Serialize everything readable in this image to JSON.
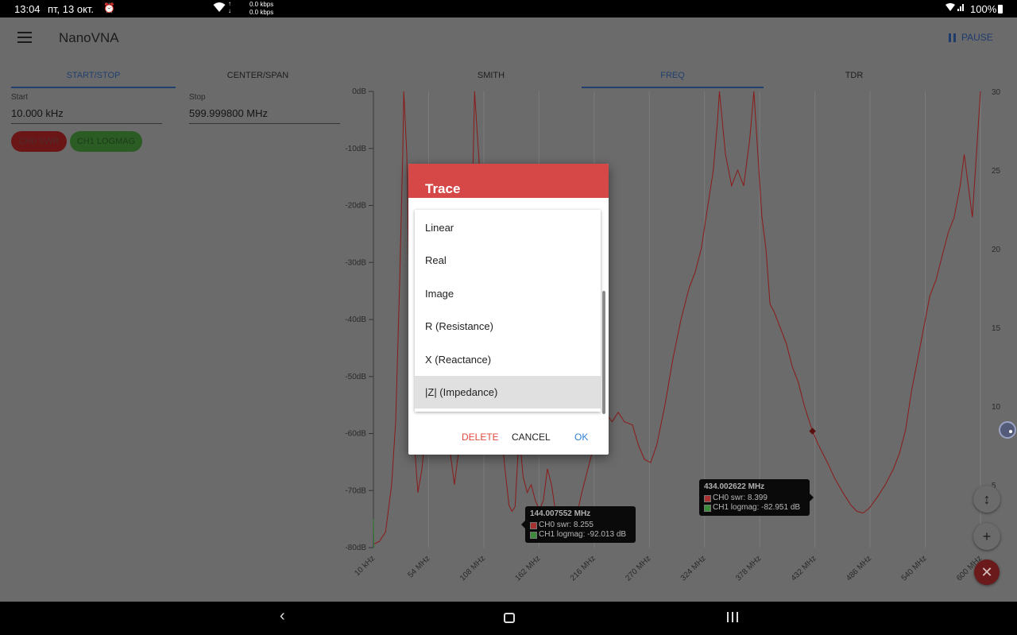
{
  "status": {
    "time": "13:04",
    "date": "пт, 13 окт.",
    "speed_up": "0.0 kbps",
    "speed_down": "0.0 kbps",
    "battery": "100%",
    "icons": [
      "alarm-icon",
      "wifi-icon",
      "data-arrows-icon",
      "wifi-signal-icon",
      "battery-icon"
    ]
  },
  "app": {
    "title": "NanoVNA",
    "pause_label": "PAUSE"
  },
  "left_tabs": [
    {
      "label": "START/STOP",
      "active": true
    },
    {
      "label": "CENTER/SPAN",
      "active": false
    }
  ],
  "fields": {
    "start_label": "Start",
    "start_value": "10.000 kHz",
    "stop_label": "Stop",
    "stop_value": "599.999800 MHz"
  },
  "chips": [
    {
      "label": "CH0 SWR",
      "color": "#c0392b"
    },
    {
      "label": "CH1 LOGMAG",
      "color": "#43a047"
    }
  ],
  "view_tabs": [
    {
      "label": "SMITH",
      "active": false
    },
    {
      "label": "FREQ",
      "active": true
    },
    {
      "label": "TDR",
      "active": false
    }
  ],
  "chart_data": {
    "type": "line",
    "x_unit": "MHz",
    "xlim": [
      0.01,
      600
    ],
    "x_ticks": [
      "10 kHz",
      "54 MHz",
      "108 MHz",
      "162 MHz",
      "216 MHz",
      "270 MHz",
      "324 MHz",
      "378 MHz",
      "432 MHz",
      "486 MHz",
      "540 MHz",
      "600 MHz"
    ],
    "y_left_ticks": [
      "0dB",
      "-10dB",
      "-20dB",
      "-30dB",
      "-40dB",
      "-50dB",
      "-60dB",
      "-70dB",
      "-80dB"
    ],
    "y_left_lim": [
      -80,
      0
    ],
    "y_right_ticks": [
      "30",
      "25",
      "20",
      "15",
      "10",
      "5"
    ],
    "y_right_lim": [
      1,
      30
    ],
    "grid": true,
    "series": [
      {
        "name": "CH0 swr",
        "color": "#8b1a1a",
        "axis": "right",
        "points": [
          [
            0.01,
            1.2
          ],
          [
            6,
            1.4
          ],
          [
            12,
            2
          ],
          [
            18,
            5
          ],
          [
            22,
            9
          ],
          [
            26,
            18
          ],
          [
            29,
            26
          ],
          [
            30,
            30
          ],
          [
            33,
            26
          ],
          [
            37,
            12
          ],
          [
            40,
            8
          ],
          [
            44,
            4.5
          ],
          [
            48,
            6
          ],
          [
            52,
            9
          ],
          [
            56,
            8
          ],
          [
            62,
            11
          ],
          [
            68,
            14
          ],
          [
            74,
            8
          ],
          [
            80,
            5
          ],
          [
            84,
            7
          ],
          [
            90,
            12
          ],
          [
            95,
            18
          ],
          [
            98,
            24
          ],
          [
            100,
            30
          ],
          [
            104,
            26
          ],
          [
            108,
            22
          ],
          [
            112,
            18
          ],
          [
            118,
            14
          ],
          [
            124,
            10
          ],
          [
            130,
            6
          ],
          [
            134,
            3.7
          ],
          [
            137,
            3.3
          ],
          [
            140,
            3.6
          ],
          [
            144,
            8.3
          ],
          [
            148,
            5.5
          ],
          [
            152,
            4.5
          ],
          [
            156,
            5
          ],
          [
            160,
            4
          ],
          [
            164,
            3.4
          ],
          [
            168,
            4
          ],
          [
            172,
            6
          ],
          [
            176,
            5
          ],
          [
            180,
            3.3
          ],
          [
            184,
            3.5
          ],
          [
            190,
            3.2
          ],
          [
            196,
            3.6
          ],
          [
            200,
            2.8
          ],
          [
            206,
            4.5
          ],
          [
            212,
            6
          ],
          [
            218,
            7.5
          ],
          [
            224,
            9
          ],
          [
            230,
            9.5
          ],
          [
            236,
            9
          ],
          [
            242,
            9.6
          ],
          [
            248,
            9
          ],
          [
            256,
            8.8
          ],
          [
            262,
            7.5
          ],
          [
            268,
            6.6
          ],
          [
            274,
            6.4
          ],
          [
            280,
            7.5
          ],
          [
            288,
            10
          ],
          [
            296,
            13
          ],
          [
            304,
            15.5
          ],
          [
            312,
            17.5
          ],
          [
            318,
            18.5
          ],
          [
            324,
            20
          ],
          [
            330,
            22.5
          ],
          [
            336,
            25
          ],
          [
            340,
            28
          ],
          [
            342,
            30
          ],
          [
            348,
            26
          ],
          [
            354,
            24
          ],
          [
            360,
            25
          ],
          [
            366,
            24
          ],
          [
            372,
            27
          ],
          [
            376,
            30
          ],
          [
            380,
            26
          ],
          [
            384,
            22
          ],
          [
            388,
            20
          ],
          [
            392,
            16.5
          ],
          [
            396,
            16
          ],
          [
            402,
            15
          ],
          [
            408,
            14
          ],
          [
            414,
            12.5
          ],
          [
            420,
            11.5
          ],
          [
            426,
            10
          ],
          [
            434,
            8.4
          ],
          [
            440,
            7.5
          ],
          [
            448,
            6.5
          ],
          [
            456,
            5.4
          ],
          [
            464,
            4.5
          ],
          [
            472,
            3.7
          ],
          [
            478,
            3.3
          ],
          [
            484,
            3.2
          ],
          [
            490,
            3.5
          ],
          [
            498,
            4.2
          ],
          [
            506,
            5
          ],
          [
            514,
            6
          ],
          [
            520,
            7
          ],
          [
            526,
            8.5
          ],
          [
            532,
            11
          ],
          [
            538,
            13
          ],
          [
            544,
            15
          ],
          [
            550,
            17
          ],
          [
            556,
            18
          ],
          [
            562,
            19.5
          ],
          [
            568,
            21
          ],
          [
            574,
            22
          ],
          [
            580,
            24
          ],
          [
            584,
            26
          ],
          [
            588,
            24
          ],
          [
            592,
            22
          ],
          [
            596,
            26
          ],
          [
            600,
            30
          ]
        ]
      },
      {
        "name": "CH1 logmag",
        "color": "#2e7d32",
        "axis": "left",
        "points": [
          [
            0.01,
            -75
          ],
          [
            0.5,
            -80
          ]
        ]
      }
    ],
    "markers": [
      {
        "freq": "144.007552 MHz",
        "x": 144.007552,
        "ch0_label": "CH0 swr: 8.255",
        "ch1_label": "CH1 logmag: -92.013 dB"
      },
      {
        "freq": "434.002622 MHz",
        "x": 434.002622,
        "ch0_label": "CH0 swr: 8.399",
        "ch1_label": "CH1 logmag: -82.951 dB"
      }
    ]
  },
  "dialog": {
    "title": "Trace",
    "options": [
      {
        "label": "Linear",
        "selected": false
      },
      {
        "label": "Real",
        "selected": false
      },
      {
        "label": "Image",
        "selected": false
      },
      {
        "label": "R (Resistance)",
        "selected": false
      },
      {
        "label": "X (Reactance)",
        "selected": false
      },
      {
        "label": "|Z| (Impedance)",
        "selected": true
      }
    ],
    "delete_label": "DELETE",
    "cancel_label": "CANCEL",
    "ok_label": "OK"
  },
  "fabs": {
    "resize_symbol": "↕",
    "add_symbol": "+",
    "close_symbol": "✕"
  },
  "nav": {
    "back_symbol": "‹"
  }
}
